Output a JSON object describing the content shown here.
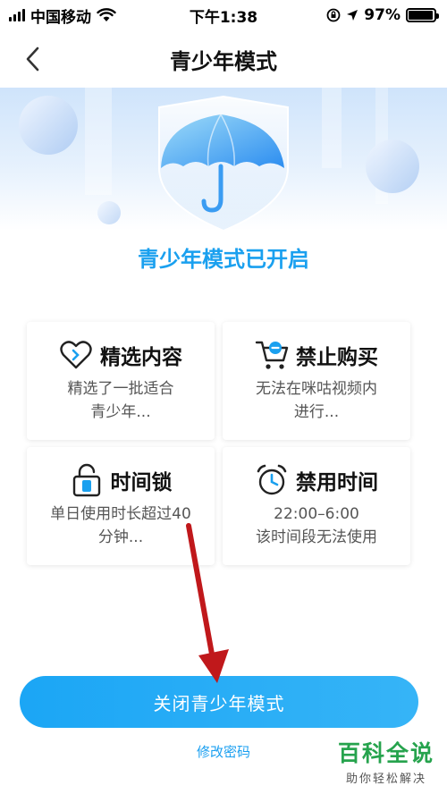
{
  "status_bar": {
    "carrier": "中国移动",
    "time": "下午1:38",
    "battery": "97%",
    "battery_level": 0.97,
    "icons": [
      "signal-icon",
      "wifi-icon",
      "rotation-lock-icon",
      "location-icon",
      "battery-icon"
    ]
  },
  "nav": {
    "title": "青少年模式",
    "back_icon": "chevron-left-icon"
  },
  "banner": {
    "icon": "umbrella-shield-icon"
  },
  "status_heading": "青少年模式已开启",
  "features": [
    {
      "title": "精选内容",
      "desc_line1": "精选了一批适合",
      "desc_line2": "青少年...",
      "icon": "heart-icon"
    },
    {
      "title": "禁止购买",
      "desc_line1": "无法在咪咕视频内",
      "desc_line2": "进行...",
      "icon": "cart-icon"
    },
    {
      "title": "时间锁",
      "desc_line1": "单日使用时长超过40",
      "desc_line2": "分钟...",
      "icon": "lock-icon"
    },
    {
      "title": "禁用时间",
      "desc_line1": "22:00–6:00",
      "desc_line2": "该时间段无法使用",
      "icon": "alarm-clock-icon"
    }
  ],
  "actions": {
    "close_label": "关闭青少年模式",
    "change_password_label": "修改密码"
  },
  "watermark": {
    "title": "百科全说",
    "subtitle": "助你轻松解决"
  },
  "colors": {
    "accent": "#1aa0ef",
    "button": "#1ba6f5",
    "annotation_arrow": "#c0181b",
    "watermark": "#26a34d"
  }
}
